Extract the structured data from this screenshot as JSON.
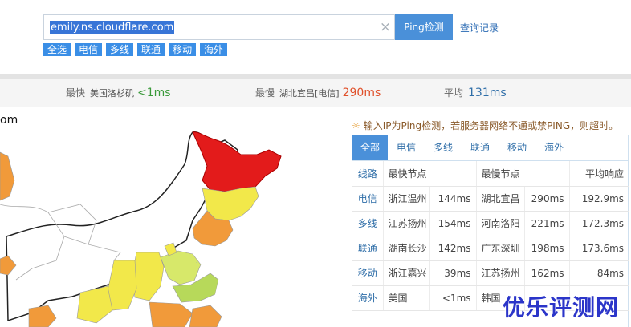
{
  "search": {
    "value": "emily.ns.cloudflare.com",
    "clear_glyph": "×",
    "ping_label": "Ping检测",
    "history_label": "查询记录"
  },
  "filters": [
    "全选",
    "电信",
    "多线",
    "联通",
    "移动",
    "海外"
  ],
  "stats": {
    "fastest_label": "最快",
    "fastest_node": "美国洛杉矶",
    "fastest_value": "<1ms",
    "slowest_label": "最慢",
    "slowest_node": "湖北宜昌[电信]",
    "slowest_value": "290ms",
    "average_label": "平均",
    "average_value": "131ms"
  },
  "map": {
    "edge_text": "om"
  },
  "note": "输入IP为Ping检测，若服务器网络不通或禁PING，则超时。",
  "tabs": [
    "全部",
    "电信",
    "多线",
    "联通",
    "移动",
    "海外"
  ],
  "table": {
    "headers": [
      "线路",
      "最快节点",
      "最慢节点",
      "平均响应"
    ],
    "rows": [
      {
        "line": "电信",
        "fast_node": "浙江温州",
        "fast_ms": "144ms",
        "slow_node": "湖北宜昌",
        "slow_ms": "290ms",
        "avg": "192.9ms"
      },
      {
        "line": "多线",
        "fast_node": "江苏扬州",
        "fast_ms": "154ms",
        "slow_node": "河南洛阳",
        "slow_ms": "221ms",
        "avg": "172.3ms"
      },
      {
        "line": "联通",
        "fast_node": "湖南长沙",
        "fast_ms": "142ms",
        "slow_node": "广东深圳",
        "slow_ms": "198ms",
        "avg": "173.6ms"
      },
      {
        "line": "移动",
        "fast_node": "浙江嘉兴",
        "fast_ms": "39ms",
        "slow_node": "江苏扬州",
        "slow_ms": "162ms",
        "avg": "84ms"
      },
      {
        "line": "海外",
        "fast_node": "美国",
        "fast_ms": "<1ms",
        "slow_node": "韩国",
        "slow_ms": "",
        "avg": ""
      }
    ]
  },
  "watermark": "优乐评测网",
  "colors": {
    "accent": "#4a90d9",
    "fast": "#3a9a3a",
    "slow": "#e0502a",
    "average": "#2f6ea8"
  }
}
